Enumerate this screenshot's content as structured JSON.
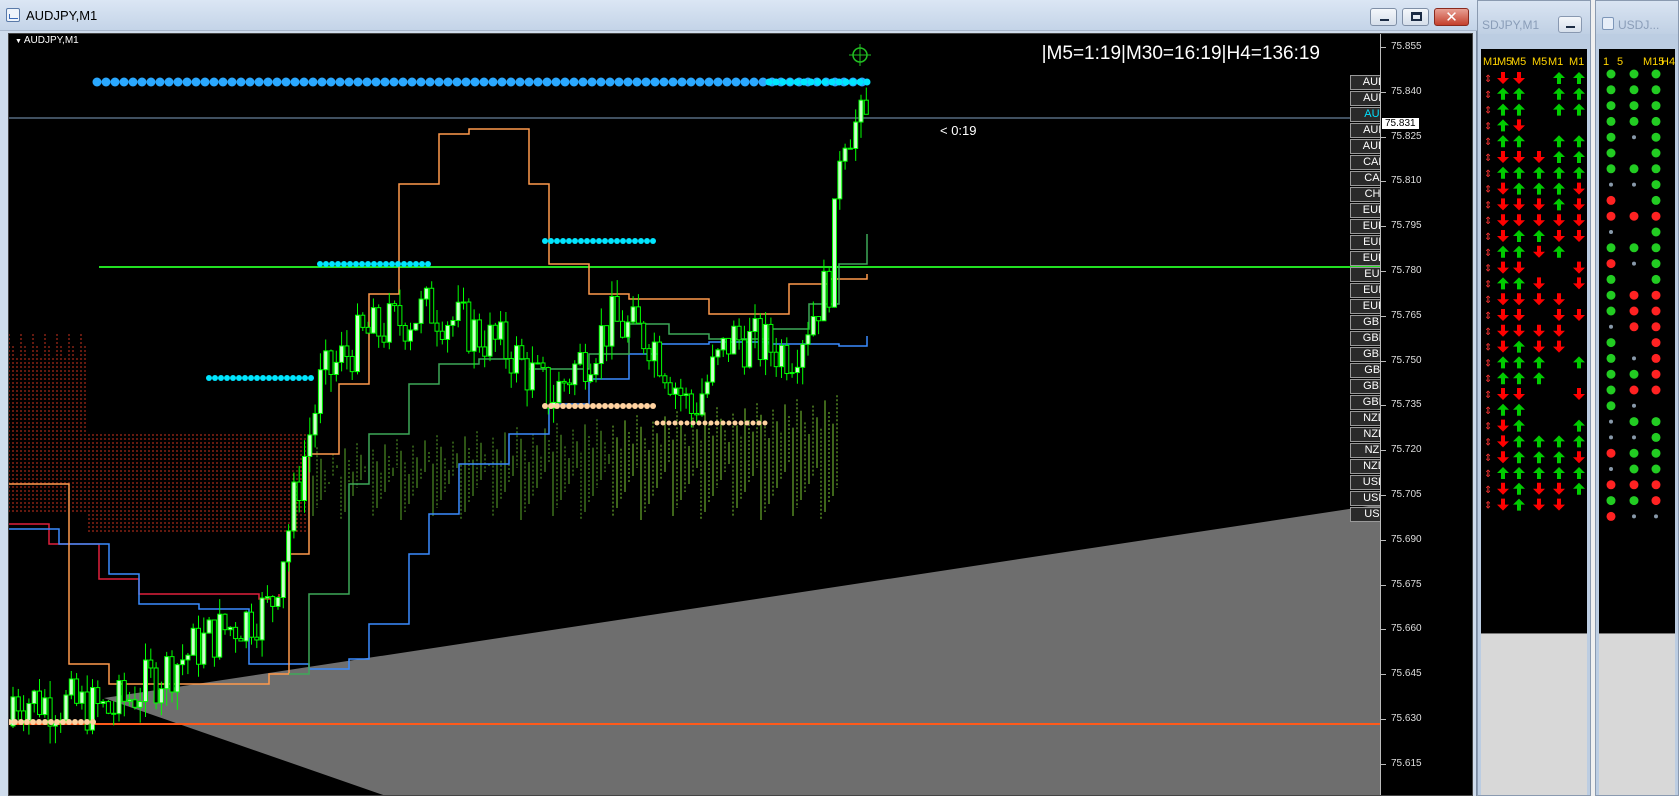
{
  "main_window": {
    "title": "AUDJPY,M1",
    "chart_label": "AUDJPY,M1",
    "timeframe_countdown": "|M5=1:19|M30=16:19|H4=136:19",
    "bar_timer": "< 0:19",
    "current_price": "75.831"
  },
  "price_scale": [
    "75.855",
    "75.840",
    "75.825",
    "75.810",
    "75.795",
    "75.780",
    "75.765",
    "75.750",
    "75.735",
    "75.720",
    "75.705",
    "75.690",
    "75.675",
    "75.660",
    "75.645",
    "75.630",
    "75.615"
  ],
  "pairs": [
    "AUDCAD",
    "AUDCHF",
    "AUDJPY",
    "AUDNZD",
    "AUDUSD",
    "CADCHF",
    "CADJPY",
    "CHFJPY",
    "EURAUD",
    "EURCAD",
    "EURCHF",
    "EURGBP",
    "EURJPY",
    "EURNZD",
    "EURUSD",
    "GBPAUD",
    "GBPCAD",
    "GBPCHF",
    "GBPJPY",
    "GBPNZD",
    "GBPUSD",
    "NZDCAD",
    "NZDCHF",
    "NZDJPY",
    "NZDUSD",
    "USDCAD",
    "USDCHF",
    "USDJPY"
  ],
  "active_pair": "AUDJPY",
  "side_panel_1": {
    "title": "SDJPY,M1",
    "headers": [
      "M1",
      "M5",
      "M5",
      "M5",
      "M1",
      "M1"
    ]
  },
  "side_panel_2": {
    "title": "USDJ...",
    "headers": [
      "1",
      "5",
      "M15",
      "H4"
    ]
  },
  "colors": {
    "bull": "#ccffcc",
    "bear": "#000000",
    "wick": "#00ff00",
    "up_arrow": "#00cc00",
    "down_arrow": "#ff0000",
    "dot_blue": "#2aa8ff",
    "dot_cyan": "#00e5ff",
    "dot_peach": "#ffd2a0"
  },
  "arrow_grid": [
    "ddd.uu",
    "duu.uu",
    "duu.uu",
    "dud...",
    "duu.uu",
    "dddduu",
    "duuuuu",
    "dduuud",
    "ddddud",
    "dddddd",
    "dduudd",
    "duudu.",
    "ddd..d",
    "duud.d",
    "ddddd.",
    "ddd.dd",
    "ddddd.",
    "ddudd.",
    "duuu.u",
    "duuu..",
    "ddd..d",
    "duu...",
    "ddu..u",
    "dduuuu",
    "dduuud",
    "duuuuu",
    "dduddu",
    "ddudd."
  ],
  "dot_grid": [
    "ggg",
    "ggg",
    "ggg",
    "ggg",
    "gng",
    "g.g",
    "ggg",
    "nng",
    "r.g",
    "rrr",
    "n.g",
    "ggg",
    "rng",
    "g.g",
    "grr",
    "grr",
    "nrr",
    "g.r",
    "gnr",
    "ggr",
    "grr",
    "gn.",
    "ngg",
    "nng",
    "rgg",
    "ngg",
    "rrr",
    "ggr",
    "rnn"
  ]
}
